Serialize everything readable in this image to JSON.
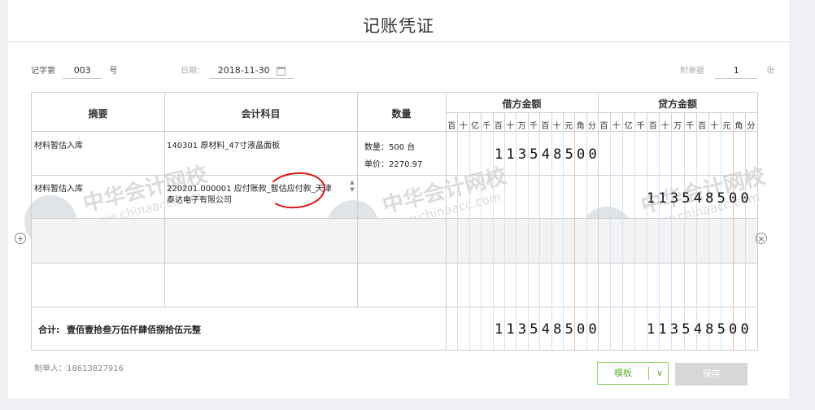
{
  "voucher": {
    "title": "记账凭证",
    "voucher_word_label": "记字第",
    "voucher_no": "003",
    "no_suffix": "号",
    "date_label": "日期：",
    "date": "2018-11-30",
    "attach_label": "附单据",
    "attach_count": "1",
    "attach_unit": "张"
  },
  "table": {
    "headers": {
      "summary": "摘要",
      "account": "会计科目",
      "quantity": "数量",
      "debit": "借方金额",
      "credit": "贷方金额"
    },
    "digit_labels": [
      "百",
      "十",
      "亿",
      "千",
      "百",
      "十",
      "万",
      "千",
      "百",
      "十",
      "元",
      "角",
      "分"
    ],
    "rows": [
      {
        "summary": "材料暂估入库",
        "account": "140301 原材料_47寸液晶面板",
        "qty_line": "数量：500 台",
        "price_line": "单价：2270.97",
        "debit": "113548500",
        "credit": ""
      },
      {
        "summary": "材料暂估入库",
        "account_line1": "220201.000001 应付账款_暂估应付款_天津",
        "account_line2": "泰达电子有限公司",
        "debit": "",
        "credit": "113548500"
      }
    ],
    "total_label": "合计:",
    "total_words": "壹佰壹拾叁万伍仟肆佰捌拾伍元整",
    "total_debit": "113548500",
    "total_credit": "113548500"
  },
  "footer": {
    "maker_label": "制单人：",
    "maker": "18613827916",
    "template_button": "模板",
    "save_button": "保存"
  },
  "watermark": {
    "text": "中华会计网校",
    "url": "www.chinaacc.com"
  },
  "colors": {
    "accent_green": "#5cb531",
    "disabled_gray": "#d7d7d7",
    "annotation_red": "#d11111"
  },
  "icons": [
    "calendar-icon",
    "add-row-icon",
    "delete-row-icon",
    "chevron-down-icon",
    "scroll-up-icon",
    "scroll-down-icon"
  ]
}
